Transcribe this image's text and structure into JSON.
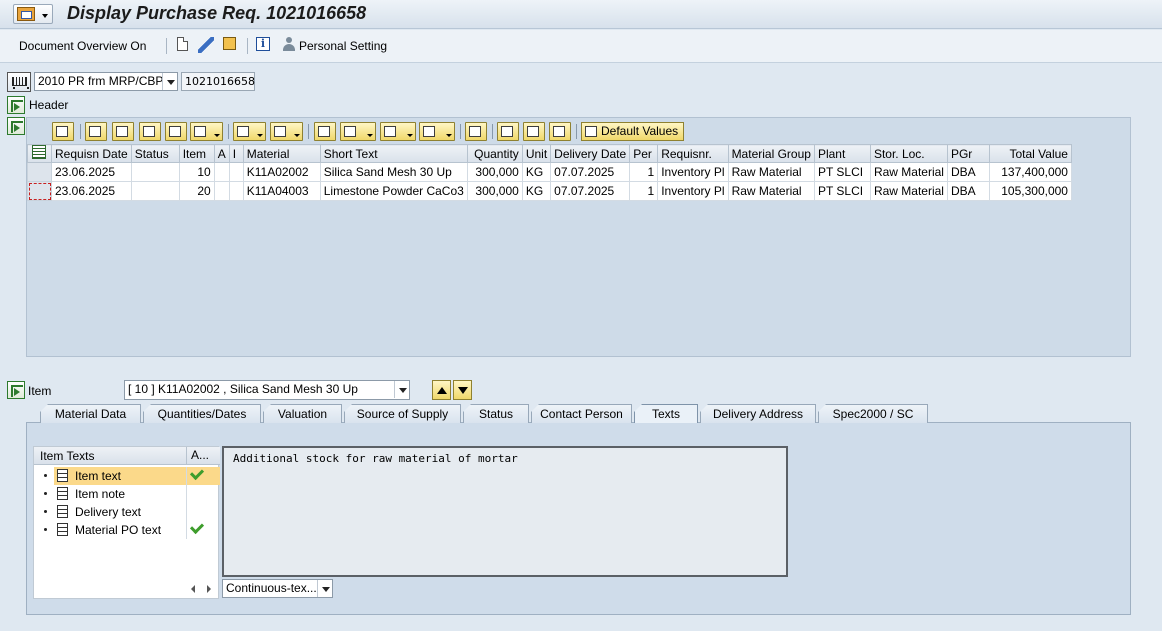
{
  "titlebar": {
    "title": "Display Purchase Req. 1021016658",
    "menu_icon": "sap-menu-icon"
  },
  "apptoolbar": {
    "document_overview": "Document Overview On",
    "personal_setting": "Personal Setting",
    "icons": [
      "new-document-icon",
      "edit-icon",
      "copy-icon",
      "info-icon",
      "person-icon"
    ]
  },
  "pr_type": {
    "selected": "2010 PR frm MRP/CBP",
    "number": "1021016658"
  },
  "header": {
    "label": "Header"
  },
  "grid": {
    "toolbar": {
      "default_values": "Default Values"
    },
    "columns": [
      "Requisn Date",
      "Status",
      "Item",
      "A",
      "I",
      "Material",
      "Short Text",
      "Quantity",
      "Unit",
      "Delivery Date",
      "Per",
      "Requisnr.",
      "Material Group",
      "Plant",
      "Stor. Loc.",
      "PGr",
      "Total Value"
    ],
    "rows": [
      {
        "requisn_date": "23.06.2025",
        "status": "",
        "item": "10",
        "a": "",
        "i": "",
        "material": "K11A02002",
        "short_text": "Silica Sand Mesh 30 Up",
        "quantity": "300,000",
        "unit": "KG",
        "delivery_date": "07.07.2025",
        "per": "1",
        "requisnr": "Inventory Pl",
        "material_group": "Raw Material",
        "plant": "PT SLCI",
        "stor_loc": "Raw Material",
        "pgr": "DBA",
        "total_value": "137,400,000"
      },
      {
        "requisn_date": "23.06.2025",
        "status": "",
        "item": "20",
        "a": "",
        "i": "",
        "material": "K11A04003",
        "short_text": "Limestone Powder CaCo3",
        "quantity": "300,000",
        "unit": "KG",
        "delivery_date": "07.07.2025",
        "per": "1",
        "requisnr": "Inventory Pl",
        "material_group": "Raw Material",
        "plant": "PT SLCI",
        "stor_loc": "Raw Material",
        "pgr": "DBA",
        "total_value": "105,300,000"
      }
    ]
  },
  "item": {
    "label": "Item",
    "selected": "[ 10 ] K11A02002 , Silica Sand Mesh 30 Up",
    "tabs": [
      "Material Data",
      "Quantities/Dates",
      "Valuation",
      "Source of Supply",
      "Status",
      "Contact Person",
      "Texts",
      "Delivery Address",
      "Spec2000 / SC"
    ],
    "active_tab": "Texts"
  },
  "texts": {
    "tree_header": "Item Texts",
    "tree_header_col2": "A...",
    "items": [
      {
        "label": "Item text",
        "checked": true,
        "selected": true
      },
      {
        "label": "Item note",
        "checked": false,
        "selected": false
      },
      {
        "label": "Delivery text",
        "checked": false,
        "selected": false
      },
      {
        "label": "Material PO text",
        "checked": true,
        "selected": false
      }
    ],
    "content": "Additional stock for raw material of mortar",
    "format": "Continuous-tex..."
  },
  "colors": {
    "background": "#dfe8f1",
    "button_yellow": "#f0d86a",
    "selection": "#fbd98a",
    "check_green": "#3e9d2c"
  }
}
